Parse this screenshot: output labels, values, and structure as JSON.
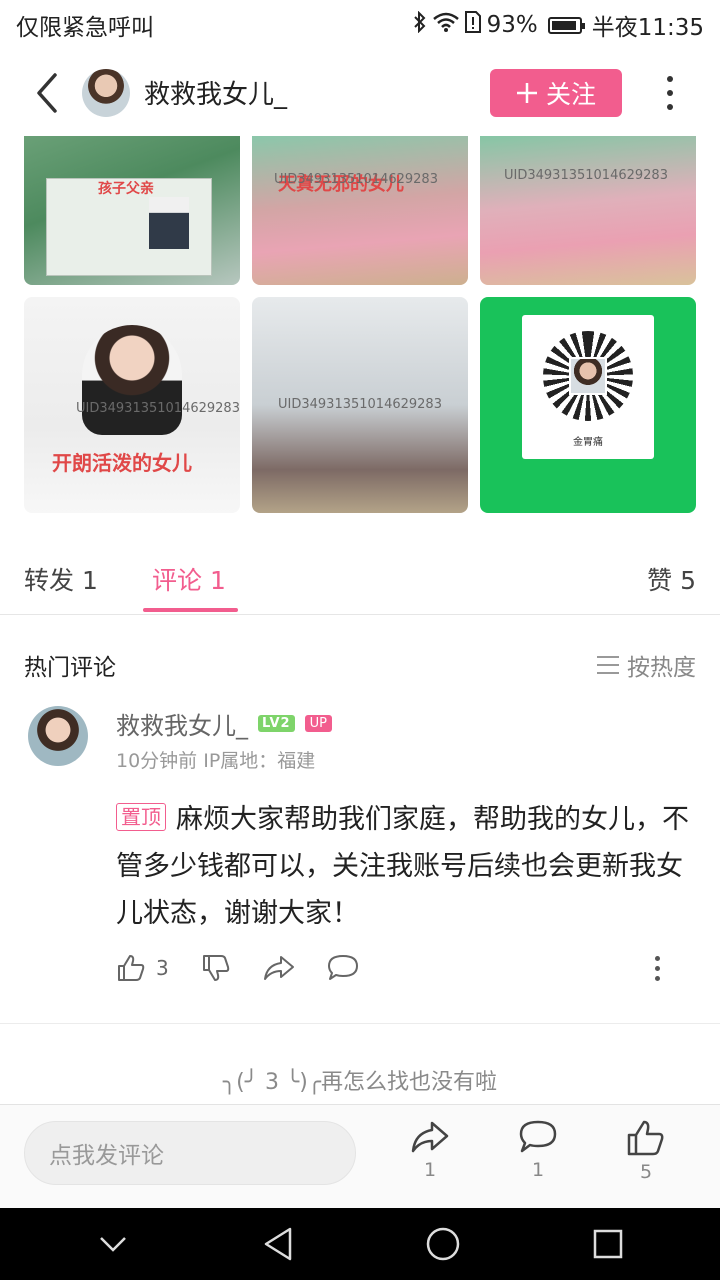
{
  "status_bar": {
    "left_text": "仅限紧急呼叫",
    "battery": "93%",
    "time": "半夜11:35",
    "battery_level": 0.93
  },
  "header": {
    "username": "救救我女儿_",
    "follow_label": "关注"
  },
  "images": {
    "img1_caption": "孩子父亲",
    "img2_caption": "天真无邪的女儿",
    "img2_uid": "UID34931351014629283",
    "img3_uid": "UID34931351014629283",
    "img4_caption": "开朗活泼的女儿",
    "img4_uid": "UID34931351014629283",
    "img5_uid": "UID34931351014629283",
    "img6_caption": "金胃痛"
  },
  "tabs": {
    "forward": "转发 1",
    "comment": "评论 1",
    "like": "赞 5"
  },
  "hot": {
    "title": "热门评论",
    "sort_label": "按热度"
  },
  "comment": {
    "username": "救救我女儿_",
    "level_badge": "LV2",
    "up_badge": "UP",
    "time": "10分钟前",
    "ip": "IP属地：福建",
    "pinned_label": "置顶",
    "text": "麻烦大家帮助我们家庭，帮助我的女儿，不管多少钱都可以，关注我账号后续也会更新我女儿状态，谢谢大家！",
    "like_count": "3"
  },
  "end_note": "╮(╯ 3 ╰)╭再怎么找也没有啦",
  "bottom_bar": {
    "input_placeholder": "点我发评论",
    "share_count": "1",
    "comment_count": "1",
    "like_count": "5"
  },
  "colors": {
    "accent": "#f25d8e",
    "level_green": "#7ed46a",
    "wechat_green": "#19c25a"
  }
}
